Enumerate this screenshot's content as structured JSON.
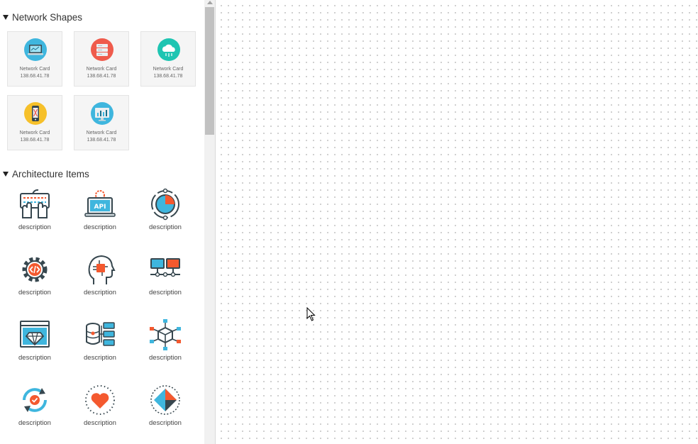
{
  "sections": {
    "network": {
      "title": "Network Shapes",
      "items": [
        {
          "name": "Network Card",
          "ip": "138.68.41.78",
          "icon": "laptop-icon",
          "color": "#3fb6de"
        },
        {
          "name": "Network Card",
          "ip": "138.68.41.78",
          "icon": "server-icon",
          "color": "#ef5b4c"
        },
        {
          "name": "Network Card",
          "ip": "138.68.41.78",
          "icon": "cloud-icon",
          "color": "#1ec5b2"
        },
        {
          "name": "Network Card",
          "ip": "138.68.41.78",
          "icon": "mobile-icon",
          "color": "#f6c02a"
        },
        {
          "name": "Network Card",
          "ip": "138.68.41.78",
          "icon": "monitor-chart-icon",
          "color": "#3fb6de"
        }
      ]
    },
    "architecture": {
      "title": "Architecture Items",
      "items": [
        {
          "label": "description",
          "icon": "keyboard-hands-icon"
        },
        {
          "label": "description",
          "icon": "api-laptop-icon"
        },
        {
          "label": "description",
          "icon": "pie-cycle-icon"
        },
        {
          "label": "description",
          "icon": "code-gear-icon"
        },
        {
          "label": "description",
          "icon": "ai-head-icon"
        },
        {
          "label": "description",
          "icon": "network-computers-icon"
        },
        {
          "label": "description",
          "icon": "diamond-browser-icon"
        },
        {
          "label": "description",
          "icon": "database-icon"
        },
        {
          "label": "description",
          "icon": "cube-network-icon"
        },
        {
          "label": "description",
          "icon": "sync-check-icon"
        },
        {
          "label": "description",
          "icon": "heart-icon"
        },
        {
          "label": "description",
          "icon": "compass-icon"
        }
      ]
    }
  },
  "colors": {
    "accent_blue": "#3fb6de",
    "accent_orange": "#f4592f",
    "outline": "#37474f"
  }
}
